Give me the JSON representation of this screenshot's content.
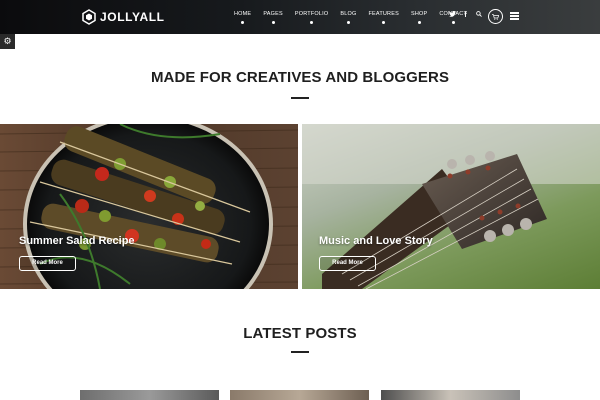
{
  "brand": {
    "name": "JOLLYALL"
  },
  "nav": {
    "items": [
      {
        "label": "HOME"
      },
      {
        "label": "PAGES"
      },
      {
        "label": "PORTFOLIO"
      },
      {
        "label": "BLOG"
      },
      {
        "label": "FEATURES"
      },
      {
        "label": "SHOP"
      },
      {
        "label": "CONTACT"
      }
    ],
    "icons": [
      {
        "name": "twitter-icon",
        "glyph": "🐦"
      },
      {
        "name": "facebook-icon",
        "glyph": "f"
      },
      {
        "name": "search-icon",
        "glyph": "🔍"
      }
    ],
    "cart_icon": "🛒"
  },
  "settings_icon": "⚙",
  "section1": {
    "title": "MADE FOR CREATIVES AND BLOGGERS"
  },
  "cards": [
    {
      "title": "Summer Salad Recipe",
      "button": "Read More"
    },
    {
      "title": "Music and Love Story",
      "button": "Read More"
    }
  ],
  "section2": {
    "title": "LATEST POSTS"
  }
}
